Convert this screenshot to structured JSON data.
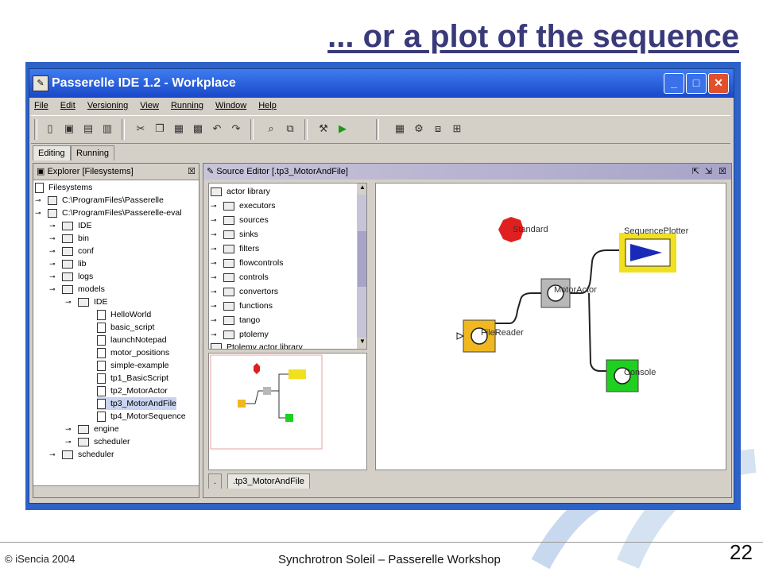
{
  "slide": {
    "title": "... or a plot of the sequence",
    "copyright": "© iSencia 2004",
    "footer": "Synchrotron Soleil – Passerelle Workshop",
    "page_number": "22"
  },
  "window": {
    "title": "Passerelle IDE 1.2 - Workplace",
    "controls": [
      "minimize-icon",
      "maximize-icon",
      "close-icon"
    ]
  },
  "menu": [
    "File",
    "Edit",
    "Versioning",
    "View",
    "Running",
    "Window",
    "Help"
  ],
  "mode_tabs": [
    "Editing",
    "Running"
  ],
  "explorer": {
    "title": "Explorer [Filesystems]",
    "tree": [
      "Filesystems",
      "C:\\ProgramFiles\\Passerelle",
      "C:\\ProgramFiles\\Passerelle-eval",
      "IDE",
      "bin",
      "conf",
      "lib",
      "logs",
      "models",
      "IDE",
      "HelloWorld",
      "basic_script",
      "launchNotepad",
      "motor_positions",
      "simple-example",
      "tp1_BasicScript",
      "tp2_MotorActor",
      "tp3_MotorAndFile",
      "tp4_MotorSequence",
      "engine",
      "scheduler",
      "scheduler"
    ]
  },
  "editor": {
    "title": "Source Editor [.tp3_MotorAndFile]",
    "library": [
      "actor library",
      "executors",
      "sources",
      "sinks",
      "filters",
      "flowcontrols",
      "controls",
      "convertors",
      "functions",
      "tango",
      "ptolemy",
      "Ptolemy actor library"
    ],
    "bottom_tabs": [
      ".",
      ".tp3_MotorAndFile"
    ],
    "actors": {
      "director": "Standard",
      "plotter": "SequencePlotter",
      "motor": "MotorActor",
      "reader": "FileReader",
      "console": "Console"
    }
  },
  "colors": {
    "title": "#3a3a7a",
    "titlebar": "#2458d8",
    "director": "#e02020",
    "plotter_frame": "#f0e020",
    "plotter_arrow": "#1a2ab8",
    "motor": "#b8b8b8",
    "reader": "#f0b820",
    "console": "#20d020"
  }
}
